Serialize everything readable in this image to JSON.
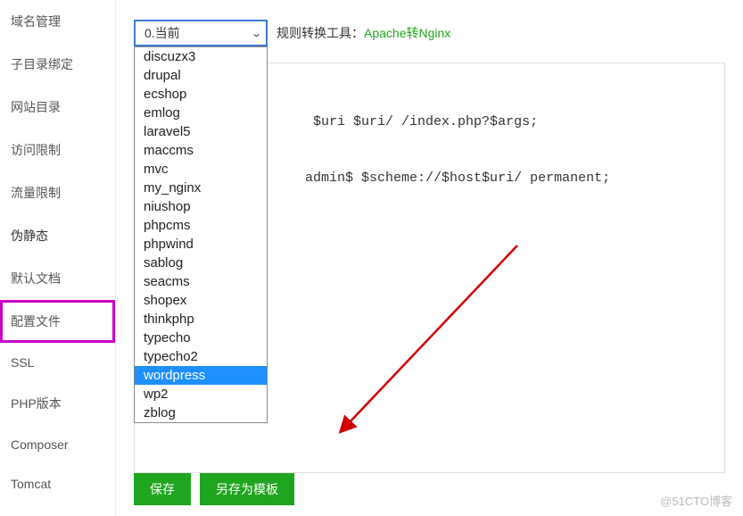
{
  "sidebar": {
    "items": [
      {
        "label": "域名管理"
      },
      {
        "label": "子目录绑定"
      },
      {
        "label": "网站目录"
      },
      {
        "label": "访问限制"
      },
      {
        "label": "流量限制"
      },
      {
        "label": "伪静态"
      },
      {
        "label": "默认文档"
      },
      {
        "label": "配置文件"
      },
      {
        "label": "SSL"
      },
      {
        "label": "PHP版本"
      },
      {
        "label": "Composer"
      },
      {
        "label": "Tomcat"
      }
    ]
  },
  "select": {
    "current": "0.当前",
    "options": [
      "discuzx3",
      "drupal",
      "ecshop",
      "emlog",
      "laravel5",
      "maccms",
      "mvc",
      "my_nginx",
      "niushop",
      "phpcms",
      "phpwind",
      "sablog",
      "seacms",
      "shopex",
      "thinkphp",
      "typecho",
      "typecho2",
      "wordpress",
      "wp2",
      "zblog"
    ],
    "selected_index": 17
  },
  "rule": {
    "label": "规则转换工具：",
    "link": "Apache转Nginx"
  },
  "code": {
    "line1_suffix": " $uri $uri/ /index.php?$args;",
    "line2_suffix": "admin$ $scheme://$host$uri/ permanent;"
  },
  "buttons": {
    "save": "保存",
    "template": "另存为模板"
  },
  "watermark": "@51CTO博客"
}
